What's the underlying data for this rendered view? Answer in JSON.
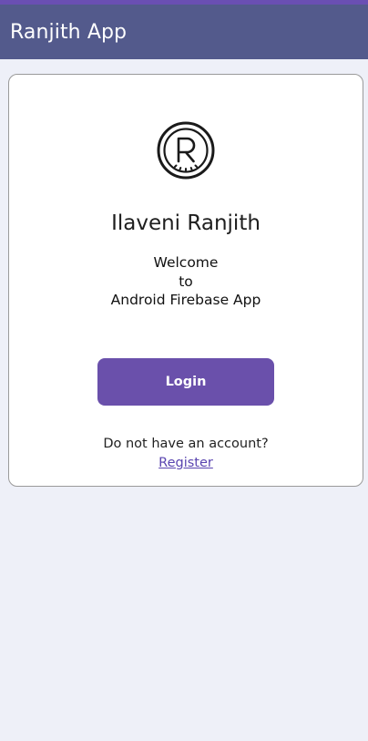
{
  "app_bar": {
    "title": "Ranjith App"
  },
  "card": {
    "logo_icon": "r-monogram-logo",
    "name": "Ilaveni Ranjith",
    "welcome_lines": [
      "Welcome",
      "to",
      "Android Firebase App"
    ],
    "login_label": "Login",
    "account_prompt": "Do not have an account?",
    "register_label": "Register"
  },
  "colors": {
    "app_bar": "#535a8c",
    "status_strip": "#6a4fb3",
    "button": "#6a50ab",
    "link": "#5a45b0",
    "background": "#eef0f8"
  }
}
